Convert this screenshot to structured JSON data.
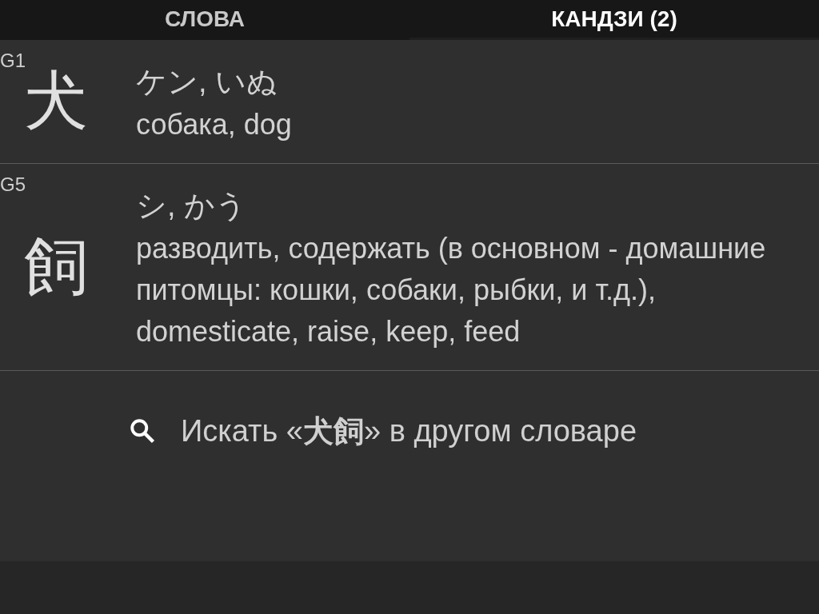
{
  "tabs": [
    {
      "label": "СЛОВА",
      "selected": false
    },
    {
      "label": "КАНДЗИ (2)",
      "selected": true
    }
  ],
  "kanji": [
    {
      "grade": "G1",
      "character": "犬",
      "readings": "ケン, いぬ",
      "meanings": "собака, dog"
    },
    {
      "grade": "G5",
      "character": "飼",
      "readings": "シ, かう",
      "meanings": "разводить, содержать (в основном - домашние питомцы: кошки, собаки, рыбки, и т.д.), domesticate, raise, keep, feed"
    }
  ],
  "search_link": "Искать «**犬飼**» в другом словаре"
}
